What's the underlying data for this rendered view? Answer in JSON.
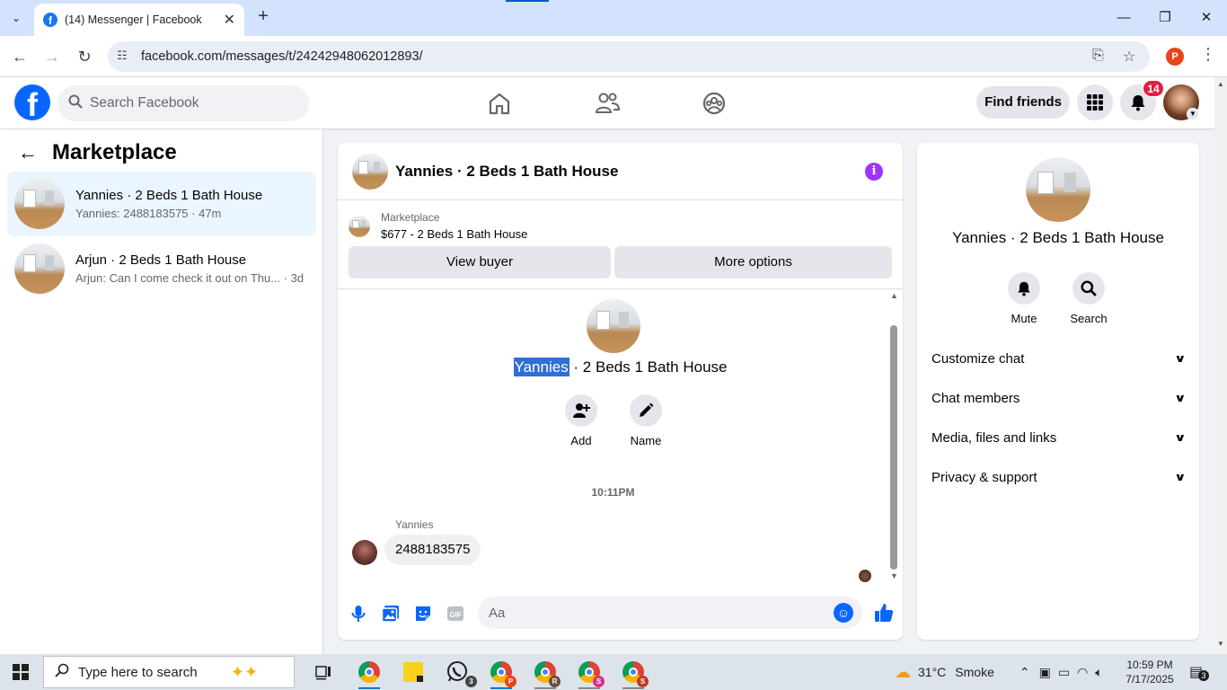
{
  "browser": {
    "tab_title": "(14) Messenger | Facebook",
    "url": "facebook.com/messages/t/24242948062012893/",
    "profile_initial": "P"
  },
  "fb": {
    "search_placeholder": "Search Facebook",
    "find_friends": "Find friends",
    "notif_count": "14"
  },
  "left": {
    "title": "Marketplace",
    "conversations": [
      {
        "name": "Yannies · 2 Beds 1 Bath House",
        "preview": "Yannies: 2488183575 · 47m"
      },
      {
        "name": "Arjun · 2 Beds 1 Bath House",
        "preview": "Arjun: Can I come check it out on Thu... · 3d"
      }
    ]
  },
  "chat": {
    "title": "Yannies · 2 Beds 1 Bath House",
    "listing_source": "Marketplace",
    "listing_price": "$677 - 2 Beds 1 Bath House",
    "view_buyer": "View buyer",
    "more_options": "More options",
    "big_name_highlight": "Yannies",
    "big_name_rest": " · 2 Beds 1 Bath House",
    "add_label": "Add",
    "name_label": "Name",
    "timestamp": "10:11PM",
    "sender": "Yannies",
    "message": "2488183575",
    "input_placeholder": "Aa"
  },
  "right": {
    "name": "Yannies · 2 Beds 1 Bath House",
    "mute_label": "Mute",
    "search_label": "Search",
    "sections": [
      "Customize chat",
      "Chat members",
      "Media, files and links",
      "Privacy & support"
    ]
  },
  "taskbar": {
    "search_placeholder": "Type here to search",
    "weather_temp": "31°C",
    "weather_desc": "Smoke",
    "time": "10:59 PM",
    "date": "7/17/2025",
    "whatsapp_count": "3",
    "notif_count": "3"
  },
  "colors": {
    "fb_blue": "#0866ff",
    "selected_bg": "#ebf5ff",
    "badge_red": "#e41e3f",
    "info_purple": "#a033ff"
  }
}
